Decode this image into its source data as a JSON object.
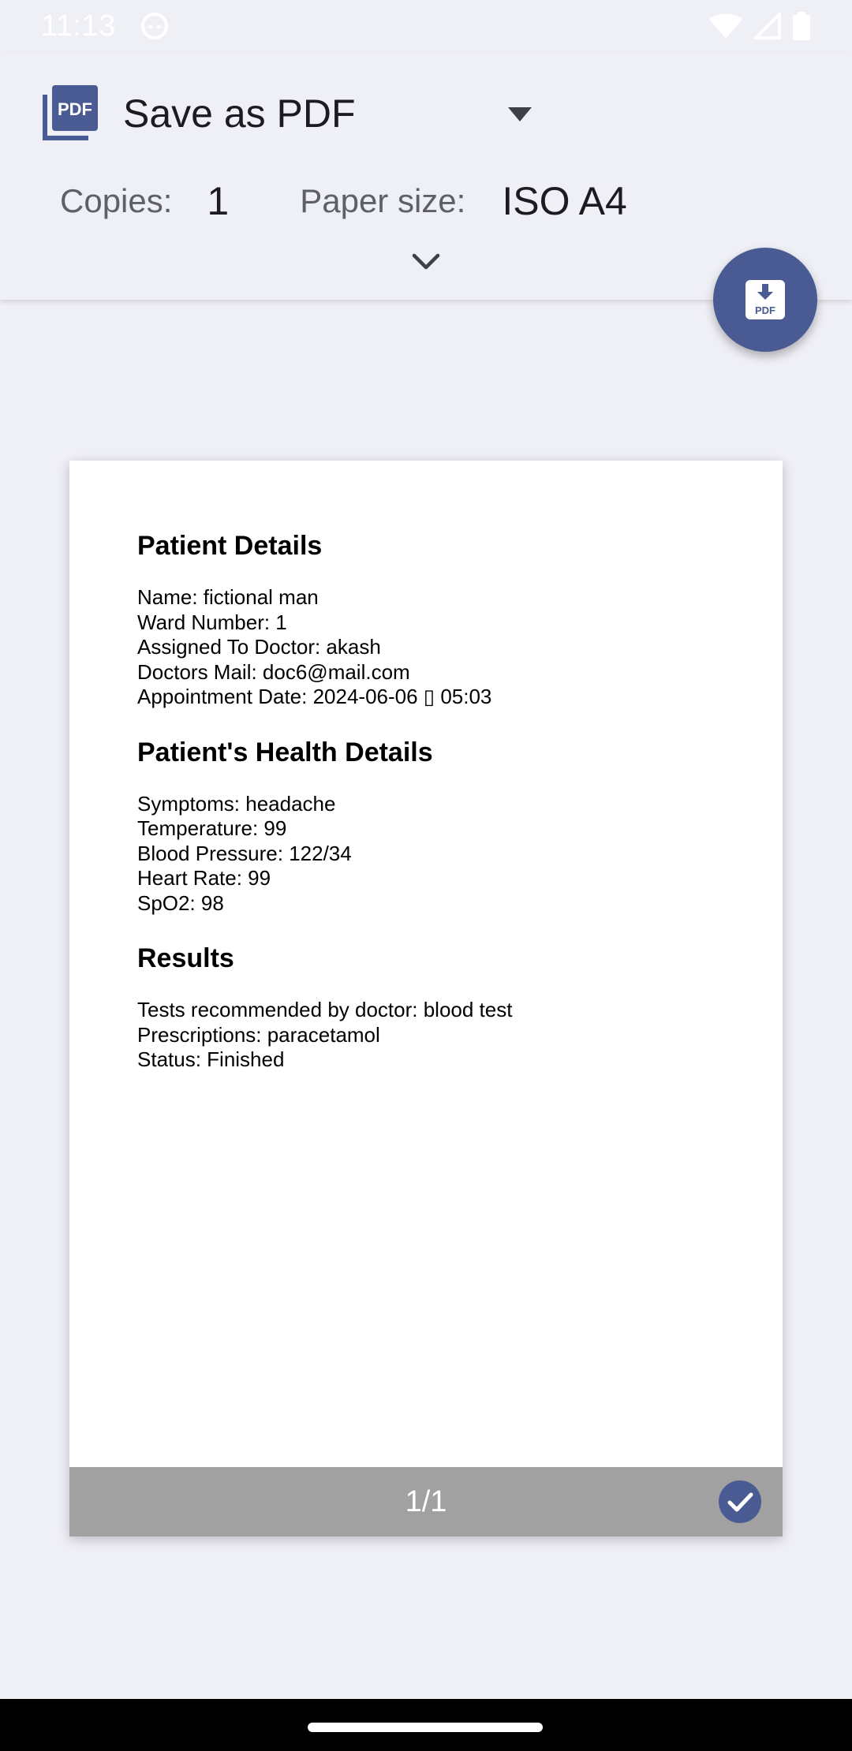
{
  "status_bar": {
    "time": "11:13"
  },
  "header": {
    "printer_name": "Save as PDF",
    "copies_label": "Copies:",
    "copies_value": "1",
    "paper_size_label": "Paper size:",
    "paper_size_value": "ISO A4"
  },
  "icons": {
    "printer_logo": "pdf-document-icon",
    "dropdown": "triangle-down-icon",
    "expand": "chevron-down-icon",
    "fab": "pdf-download-icon",
    "page_selected": "check-circle-icon"
  },
  "colors": {
    "accent": "#4a5a92",
    "background": "#efeff6",
    "page_footer": "#a1a1a1"
  },
  "document": {
    "sections": [
      {
        "heading": "Patient Details",
        "lines": [
          "Name: fictional man",
          "Ward Number: 1",
          "Assigned To Doctor: akash",
          "Doctors Mail: doc6@mail.com",
          "Appointment Date: 2024-06-06 ▯ 05:03"
        ]
      },
      {
        "heading": "Patient's Health Details",
        "lines": [
          "Symptoms: headache",
          "Temperature: 99",
          "Blood Pressure: 122/34",
          "Heart Rate: 99",
          "SpO2: 98"
        ]
      },
      {
        "heading": "Results",
        "lines": [
          "Tests recommended by doctor: blood test",
          "Prescriptions: paracetamol",
          "Status: Finished"
        ]
      }
    ]
  },
  "page_footer": {
    "page_number": "1/1"
  }
}
